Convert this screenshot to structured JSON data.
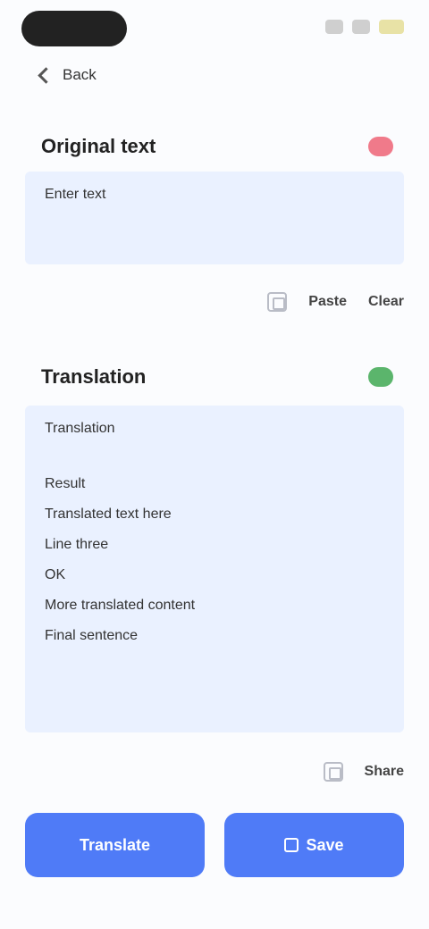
{
  "status_bar": {
    "icons": [
      "signal-icon",
      "wifi-icon",
      "battery-icon"
    ]
  },
  "nav": {
    "back_label": "Back"
  },
  "source": {
    "title": "Original text",
    "flag_color": "#f07a8a",
    "text": "Enter text",
    "actions": {
      "copy": "copy-icon",
      "paste_label": "Paste",
      "clear_label": "Clear"
    }
  },
  "result": {
    "title": "Translation",
    "flag_color": "#5bb56c",
    "text": "Translation",
    "lines": [
      "Result",
      "Translated text here",
      "Line three",
      "OK",
      "More translated content",
      "Final sentence"
    ],
    "actions": {
      "copy": "copy-icon",
      "share_label": "Share"
    }
  },
  "buttons": {
    "primary_label": "Translate",
    "secondary_label": "Save"
  },
  "colors": {
    "accent": "#4f7bf7",
    "panel": "#eaf1ff"
  }
}
